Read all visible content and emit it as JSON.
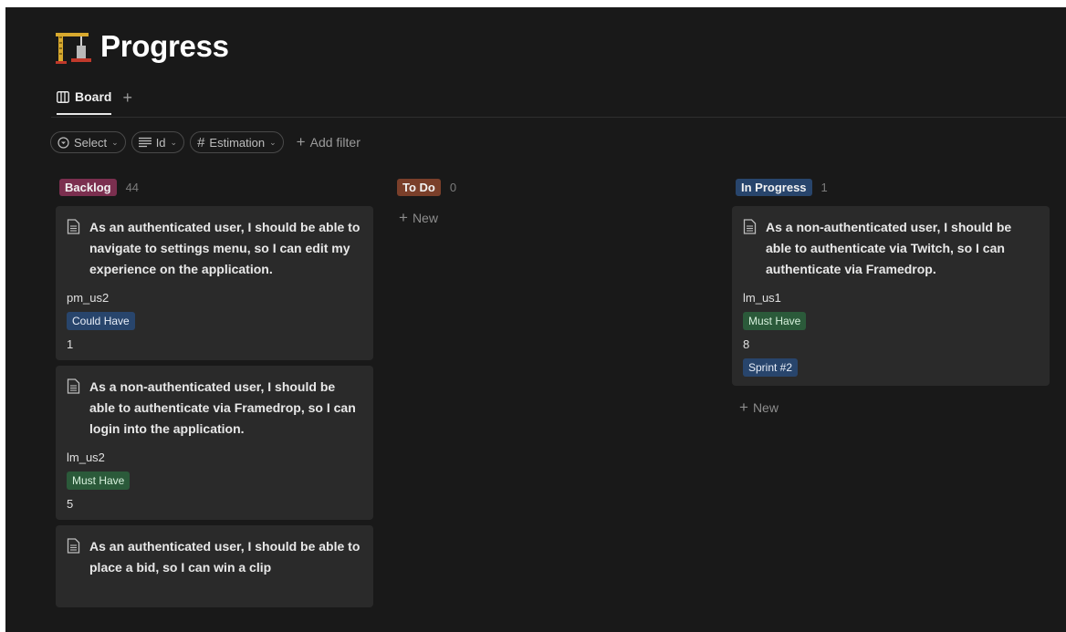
{
  "page": {
    "title": "Progress",
    "icon": "construction-crane-icon"
  },
  "views": {
    "tabs": [
      {
        "label": "Board",
        "icon": "board-icon"
      }
    ],
    "add_label": "+"
  },
  "filters": {
    "chips": [
      {
        "label": "Select",
        "icon": "select-icon"
      },
      {
        "label": "Id",
        "icon": "text-lines-icon"
      },
      {
        "label": "Estimation",
        "icon": "hash-icon"
      }
    ],
    "add_filter_label": "Add filter"
  },
  "colors": {
    "backlog": "#7b2f4f",
    "todo": "#7a3f2a",
    "in_progress": "#28456c",
    "could_have": "#28456c",
    "must_have": "#2b5a3a"
  },
  "columns": [
    {
      "label": "Backlog",
      "count": "44",
      "cards": [
        {
          "title": "As an authenticated user, I should be able to navigate to settings menu, so I can edit my experience on the application.",
          "id": "pm_us2",
          "priority": "Could Have",
          "estimation": "1"
        },
        {
          "title": "As a non-authenticated user, I should be able to authenticate via Framedrop, so I can login into the application.",
          "id": "lm_us2",
          "priority": "Must Have",
          "estimation": "5"
        },
        {
          "title": "As an authenticated user, I should be able to place a bid, so I can win a clip"
        }
      ]
    },
    {
      "label": "To Do",
      "count": "0",
      "new_label": "New"
    },
    {
      "label": "In Progress",
      "count": "1",
      "new_label": "New",
      "cards": [
        {
          "title": "As a non-authenticated user, I should be able to authenticate via Twitch, so I can authenticate via Framedrop.",
          "id": "lm_us1",
          "priority": "Must Have",
          "estimation": "8",
          "sprint": "Sprint #2"
        }
      ]
    }
  ]
}
